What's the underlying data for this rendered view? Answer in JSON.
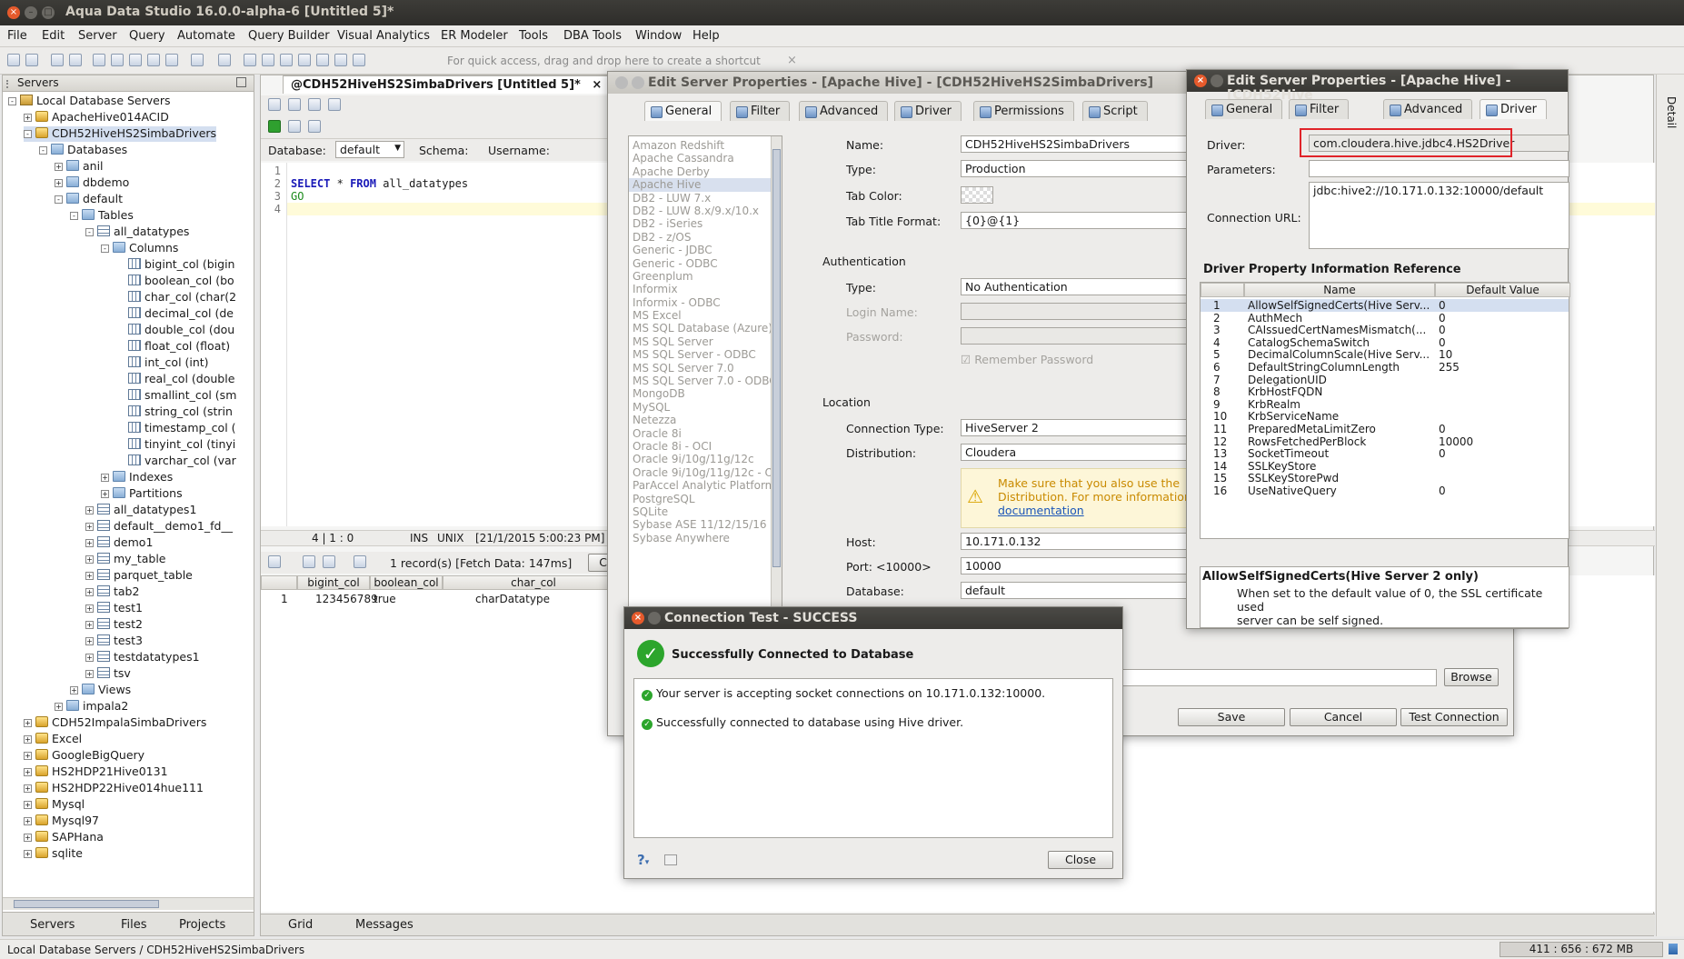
{
  "window": {
    "title": "Aqua Data Studio 16.0.0-alpha-6 [Untitled 5]*"
  },
  "menu": [
    "File",
    "Edit",
    "Server",
    "Query",
    "Automate",
    "Query Builder",
    "Visual Analytics",
    "ER Modeler",
    "Tools",
    "DBA Tools",
    "Window",
    "Help"
  ],
  "toolbar": {
    "hint": "For quick access, drag and drop here to create a shortcut",
    "hint_close": "×"
  },
  "servers_panel": {
    "title": "Servers",
    "tree": [
      {
        "label": "Local Database Servers",
        "indent": 0,
        "icon": "srv",
        "toggle": "-"
      },
      {
        "label": "ApacheHive014ACID",
        "indent": 1,
        "icon": "db",
        "toggle": "+"
      },
      {
        "label": "CDH52HiveHS2SimbaDrivers",
        "indent": 1,
        "icon": "db",
        "toggle": "-",
        "selected": true
      },
      {
        "label": "Databases",
        "indent": 2,
        "icon": "fold",
        "toggle": "-"
      },
      {
        "label": "anil",
        "indent": 3,
        "icon": "fold",
        "toggle": "+"
      },
      {
        "label": "dbdemo",
        "indent": 3,
        "icon": "fold",
        "toggle": "+"
      },
      {
        "label": "default",
        "indent": 3,
        "icon": "fold",
        "toggle": "-"
      },
      {
        "label": "Tables",
        "indent": 4,
        "icon": "fold",
        "toggle": "-"
      },
      {
        "label": "all_datatypes",
        "indent": 5,
        "icon": "tab",
        "toggle": "-"
      },
      {
        "label": "Columns",
        "indent": 6,
        "icon": "fold",
        "toggle": "-"
      },
      {
        "label": "bigint_col (bigin",
        "indent": 7,
        "icon": "col"
      },
      {
        "label": "boolean_col (bo",
        "indent": 7,
        "icon": "col"
      },
      {
        "label": "char_col (char(2",
        "indent": 7,
        "icon": "col"
      },
      {
        "label": "decimal_col (de",
        "indent": 7,
        "icon": "col"
      },
      {
        "label": "double_col (dou",
        "indent": 7,
        "icon": "col"
      },
      {
        "label": "float_col (float)",
        "indent": 7,
        "icon": "col"
      },
      {
        "label": "int_col (int)",
        "indent": 7,
        "icon": "col"
      },
      {
        "label": "real_col (double",
        "indent": 7,
        "icon": "col"
      },
      {
        "label": "smallint_col (sm",
        "indent": 7,
        "icon": "col"
      },
      {
        "label": "string_col (strin",
        "indent": 7,
        "icon": "col"
      },
      {
        "label": "timestamp_col (",
        "indent": 7,
        "icon": "col"
      },
      {
        "label": "tinyint_col (tinyi",
        "indent": 7,
        "icon": "col"
      },
      {
        "label": "varchar_col (var",
        "indent": 7,
        "icon": "col"
      },
      {
        "label": "Indexes",
        "indent": 6,
        "icon": "fold",
        "toggle": "+"
      },
      {
        "label": "Partitions",
        "indent": 6,
        "icon": "fold",
        "toggle": "+"
      },
      {
        "label": "all_datatypes1",
        "indent": 5,
        "icon": "tab",
        "toggle": "+"
      },
      {
        "label": "default__demo1_fd__",
        "indent": 5,
        "icon": "tab",
        "toggle": "+"
      },
      {
        "label": "demo1",
        "indent": 5,
        "icon": "tab",
        "toggle": "+"
      },
      {
        "label": "my_table",
        "indent": 5,
        "icon": "tab",
        "toggle": "+"
      },
      {
        "label": "parquet_table",
        "indent": 5,
        "icon": "tab",
        "toggle": "+"
      },
      {
        "label": "tab2",
        "indent": 5,
        "icon": "tab",
        "toggle": "+"
      },
      {
        "label": "test1",
        "indent": 5,
        "icon": "tab",
        "toggle": "+"
      },
      {
        "label": "test2",
        "indent": 5,
        "icon": "tab",
        "toggle": "+"
      },
      {
        "label": "test3",
        "indent": 5,
        "icon": "tab",
        "toggle": "+"
      },
      {
        "label": "testdatatypes1",
        "indent": 5,
        "icon": "tab",
        "toggle": "+"
      },
      {
        "label": "tsv",
        "indent": 5,
        "icon": "tab",
        "toggle": "+"
      },
      {
        "label": "Views",
        "indent": 4,
        "icon": "fold",
        "toggle": "+"
      },
      {
        "label": "impala2",
        "indent": 3,
        "icon": "fold",
        "toggle": "+"
      },
      {
        "label": "CDH52ImpalaSimbaDrivers",
        "indent": 1,
        "icon": "db",
        "toggle": "+"
      },
      {
        "label": "Excel",
        "indent": 1,
        "icon": "db",
        "toggle": "+"
      },
      {
        "label": "GoogleBigQuery",
        "indent": 1,
        "icon": "db",
        "toggle": "+"
      },
      {
        "label": "HS2HDP21Hive0131",
        "indent": 1,
        "icon": "db",
        "toggle": "+"
      },
      {
        "label": "HS2HDP22Hive014hue111",
        "indent": 1,
        "icon": "db",
        "toggle": "+"
      },
      {
        "label": "Mysql",
        "indent": 1,
        "icon": "db",
        "toggle": "+"
      },
      {
        "label": "Mysql97",
        "indent": 1,
        "icon": "db",
        "toggle": "+"
      },
      {
        "label": "SAPHana",
        "indent": 1,
        "icon": "db",
        "toggle": "+"
      },
      {
        "label": "sqlite",
        "indent": 1,
        "icon": "db",
        "toggle": "+"
      }
    ],
    "bottom_tabs": [
      "Servers",
      "Files",
      "Projects"
    ]
  },
  "editor": {
    "tab_title": "@CDH52HiveHS2SimbaDrivers [Untitled 5]*",
    "database_label": "Database:",
    "database_value": "default",
    "schema_label": "Schema:",
    "username_label": "Username:",
    "lines": [
      "1",
      "2",
      "3",
      "4"
    ],
    "sql_keyword": "SELECT",
    "sql_star": "*",
    "sql_from": "FROM",
    "sql_table": "all_datatypes",
    "sql_go": "GO",
    "status_pos": "4 | 1 : 0",
    "status_ins": "INS",
    "status_unix": "UNIX",
    "status_time": "[21/1/2015 5:00:23 PM]",
    "results_info": "1 record(s) [Fetch Data: 147ms]",
    "results_partial_btn": "Co",
    "grid_cols": [
      "bigint_col",
      "boolean_col",
      "char_col"
    ],
    "grid_row": [
      "1",
      "123456789",
      "true",
      "charDatatype"
    ],
    "bottom_tabs": [
      "Grid",
      "Messages"
    ]
  },
  "edit_dialog_1": {
    "title": "Edit Server Properties - [Apache Hive] - [CDH52HiveHS2SimbaDrivers]",
    "tabs": [
      "General",
      "Filter",
      "Advanced",
      "Driver",
      "Permissions",
      "Script"
    ],
    "db_types": [
      "Amazon Redshift",
      "Apache Cassandra",
      "Apache Derby",
      "Apache Hive",
      "DB2 - LUW 7.x",
      "DB2 - LUW 8.x/9.x/10.x",
      "DB2 - iSeries",
      "DB2 - z/OS",
      "Generic - JDBC",
      "Generic - ODBC",
      "Greenplum",
      "Informix",
      "Informix - ODBC",
      "MS Excel",
      "MS SQL Database (Azure)",
      "MS SQL Server",
      "MS SQL Server - ODBC",
      "MS SQL Server 7.0",
      "MS SQL Server 7.0 - ODBC",
      "MongoDB",
      "MySQL",
      "Netezza",
      "Oracle 8i",
      "Oracle 8i - OCI",
      "Oracle 9i/10g/11g/12c",
      "Oracle 9i/10g/11g/12c - OCI",
      "ParAccel Analytic Platform",
      "PostgreSQL",
      "SQLite",
      "Sybase ASE 11/12/15/16",
      "Sybase Anywhere"
    ],
    "name_label": "Name:",
    "name_value": "CDH52HiveHS2SimbaDrivers",
    "type_label": "Type:",
    "type_value": "Production",
    "tabcolor_label": "Tab Color:",
    "tabtitle_label": "Tab Title Format:",
    "tabtitle_value": "{0}@{1}",
    "auth_section": "Authentication",
    "auth_type_label": "Type:",
    "auth_type_value": "No Authentication",
    "login_label": "Login Name:",
    "password_label": "Password:",
    "remember_label": "Remember Password",
    "location_section": "Location",
    "conn_type_label": "Connection Type:",
    "conn_type_value": "HiveServer 2",
    "distribution_label": "Distribution:",
    "distribution_value": "Cloudera",
    "warning_line1": "Make sure that you also use the",
    "warning_line2": "Distribution. For more information",
    "warning_link": "documentation",
    "host_label": "Host:",
    "host_value": "10.171.0.132",
    "port_label": "Port: <10000>",
    "port_value": "10000",
    "database_label": "Database:",
    "database_value": "default",
    "browse_label": "Browse",
    "save_label": "Save",
    "cancel_label": "Cancel",
    "test_label": "Test Connection"
  },
  "edit_dialog_2": {
    "title": "Edit Server Properties - [Apache Hive] - [CDH52Hive",
    "tabs": [
      "General",
      "Filter",
      "Advanced",
      "Driver"
    ],
    "driver_label": "Driver:",
    "driver_value": "com.cloudera.hive.jdbc4.HS2Driver",
    "params_label": "Parameters:",
    "url_label": "Connection URL:",
    "url_value": "jdbc:hive2://10.171.0.132:10000/default",
    "ref_title": "Driver Property Information Reference",
    "col_name": "Name",
    "col_default": "Default Value",
    "props": [
      {
        "n": "1",
        "name": "AllowSelfSignedCerts(Hive Serv...",
        "v": "0"
      },
      {
        "n": "2",
        "name": "AuthMech",
        "v": "0"
      },
      {
        "n": "3",
        "name": "CAIssuedCertNamesMismatch(...",
        "v": "0"
      },
      {
        "n": "4",
        "name": "CatalogSchemaSwitch",
        "v": "0"
      },
      {
        "n": "5",
        "name": "DecimalColumnScale(Hive Serv...",
        "v": "10"
      },
      {
        "n": "6",
        "name": "DefaultStringColumnLength",
        "v": "255"
      },
      {
        "n": "7",
        "name": "DelegationUID",
        "v": ""
      },
      {
        "n": "8",
        "name": "KrbHostFQDN",
        "v": ""
      },
      {
        "n": "9",
        "name": "KrbRealm",
        "v": ""
      },
      {
        "n": "10",
        "name": "KrbServiceName",
        "v": ""
      },
      {
        "n": "11",
        "name": "PreparedMetaLimitZero",
        "v": "0"
      },
      {
        "n": "12",
        "name": "RowsFetchedPerBlock",
        "v": "10000"
      },
      {
        "n": "13",
        "name": "SocketTimeout",
        "v": "0"
      },
      {
        "n": "14",
        "name": "SSLKeyStore",
        "v": ""
      },
      {
        "n": "15",
        "name": "SSLKeyStorePwd",
        "v": ""
      },
      {
        "n": "16",
        "name": "UseNativeQuery",
        "v": "0"
      }
    ],
    "desc_title": "AllowSelfSignedCerts(Hive Server 2 only)",
    "desc_line1": "When set to the default value of 0, the SSL certificate used",
    "desc_line2": "server can be self signed."
  },
  "conn_test": {
    "title": "Connection Test - SUCCESS",
    "heading": "Successfully Connected to Database",
    "msg1": "Your server is accepting socket connections on 10.171.0.132:10000.",
    "msg2": "Successfully connected to database using Hive driver.",
    "help": "?",
    "close_label": "Close"
  },
  "right_edge": {
    "detail_label": "Detail"
  },
  "statusbar": {
    "path": "Local Database Servers / CDH52HiveHS2SimbaDrivers",
    "memory": "411 : 656 : 672 MB"
  },
  "colors": {
    "accent": "#4a78c2",
    "success": "#2ca52c",
    "titlebar": "#2e2d2a",
    "highlight_box": "#e0242a"
  }
}
